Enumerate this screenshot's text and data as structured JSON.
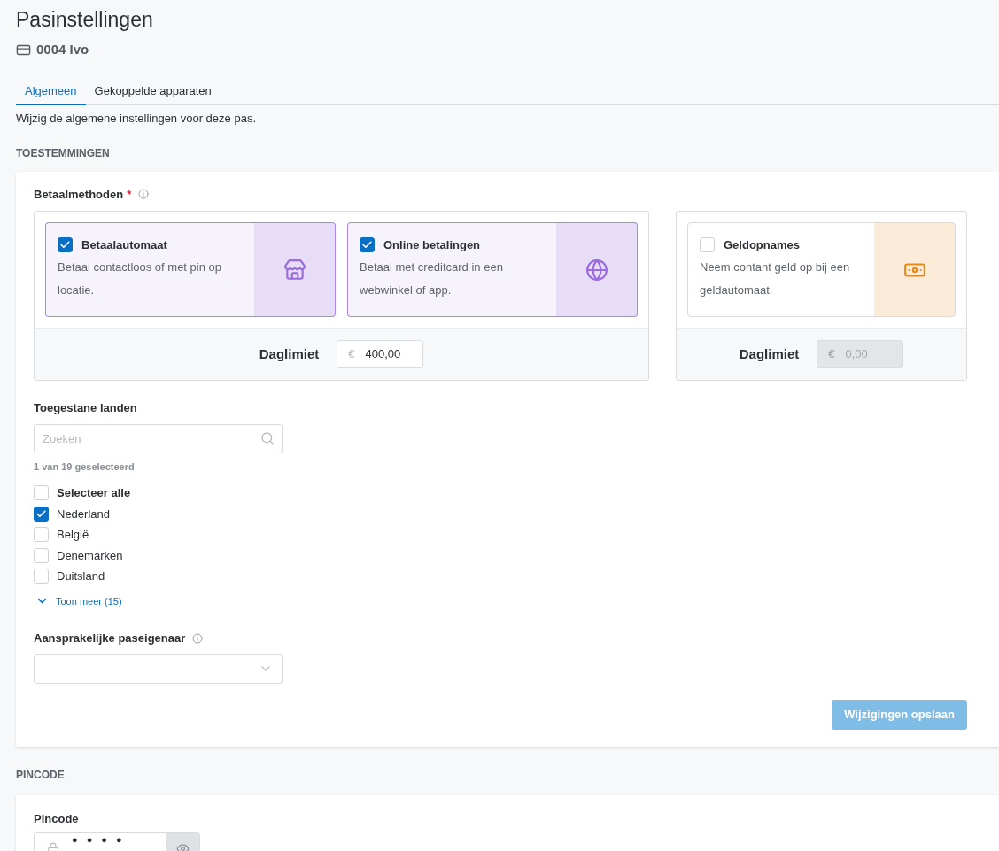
{
  "page": {
    "title": "Pasinstellingen",
    "card_label": "0004 Ivo"
  },
  "tabs": [
    {
      "label": "Algemeen",
      "selected": true
    },
    {
      "label": "Gekoppelde apparaten",
      "selected": false
    }
  ],
  "intro": "Wijzig de algemene instellingen voor deze pas.",
  "permissions": {
    "heading": "TOESTEMMINGEN",
    "payment_label": "Betaalmethoden",
    "required_mark": "*",
    "groups": [
      {
        "methods": [
          {
            "title": "Betaalautomaat",
            "description": "Betaal contactloos of met pin op locatie.",
            "checked": true,
            "kind": "store",
            "color": "#9b6bdf"
          },
          {
            "title": "Online betalingen",
            "description": "Betaal met creditcard in een webwinkel of app.",
            "checked": true,
            "kind": "globe",
            "color": "#9b6bdf"
          }
        ],
        "limit_label": "Daglimiet",
        "currency": "€",
        "limit": "400,00",
        "disabled": false
      },
      {
        "methods": [
          {
            "title": "Geldopnames",
            "description": "Neem contant geld op bij een geldautomaat.",
            "checked": false,
            "kind": "money",
            "color": "#e8891a"
          }
        ],
        "limit_label": "Daglimiet",
        "currency": "€",
        "limit": "0,00",
        "disabled": true
      }
    ],
    "countries_label": "Toegestane landen",
    "search": {
      "placeholder": "Zoeken"
    },
    "count": "1 van 19 geselecteerd",
    "select_all": {
      "label": "Selecteer alle",
      "checked": false
    },
    "countries": [
      {
        "label": "Nederland",
        "checked": true
      },
      {
        "label": "België",
        "checked": false
      },
      {
        "label": "Denemarken",
        "checked": false
      },
      {
        "label": "Duitsland",
        "checked": false
      }
    ],
    "show_more": "Toon meer (15)",
    "owner_label": "Aansprakelijke paseigenaar",
    "save_button": {
      "label": "Wijzigingen opslaan",
      "disabled": true
    }
  },
  "pincode": {
    "heading": "PINCODE",
    "label": "Pincode",
    "value": "●●●●"
  }
}
